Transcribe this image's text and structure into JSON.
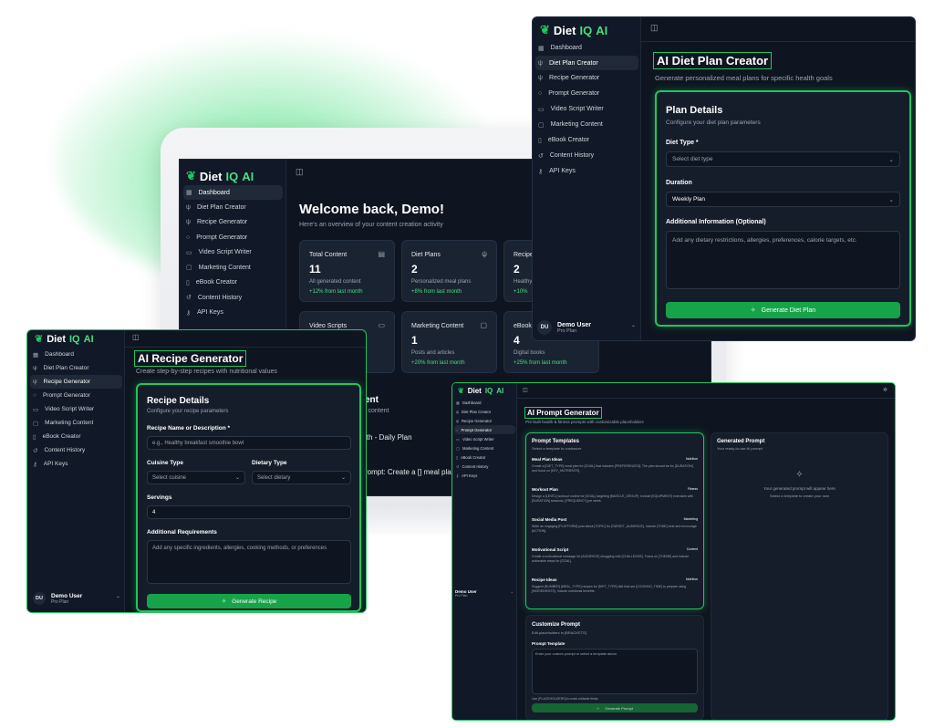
{
  "brand": {
    "diet": "Diet",
    "iq": "IQ",
    "ai": "AI"
  },
  "nav": [
    "Dashboard",
    "Diet Plan Creator",
    "Recipe Generator",
    "Prompt Generator",
    "Video Script Writer",
    "Marketing Content",
    "eBook Creator",
    "Content History",
    "API Keys"
  ],
  "user": {
    "initials": "DU",
    "name": "Demo User",
    "plan": "Pro Plan"
  },
  "dashboard": {
    "title": "Welcome back, Demo!",
    "subtitle": "Here's an overview of your content creation activity",
    "stats": [
      {
        "label": "Total Content",
        "value": "11",
        "desc": "All generated content",
        "trend": "+12% from last month"
      },
      {
        "label": "Diet Plans",
        "value": "2",
        "desc": "Personalized meal plans",
        "trend": "+8% from last month"
      },
      {
        "label": "Recipe",
        "value": "2",
        "desc": "Healthy",
        "trend": "+10%"
      },
      {
        "label": "Video Scripts",
        "value": "",
        "desc": "",
        "trend": ""
      },
      {
        "label": "Marketing Content",
        "value": "1",
        "desc": "Posts and articles",
        "trend": "+20% from last month"
      },
      {
        "label": "eBooks",
        "value": "4",
        "desc": "Digital books",
        "trend": "+25% from last month"
      }
    ],
    "recent_heading": "ent",
    "recent_sub": "l content",
    "recent_1": "lth - Daily Plan",
    "recent_2": "rompt: Create a [] meal pla"
  },
  "diet": {
    "title": "AI Diet Plan Creator",
    "subtitle": "Generate personalized meal plans for specific health goals",
    "card_title": "Plan Details",
    "card_sub": "Configure your diet plan parameters",
    "diet_type_label": "Diet Type *",
    "diet_type_placeholder": "Select diet type",
    "duration_label": "Duration",
    "duration_value": "Weekly Plan",
    "info_label": "Additional Information (Optional)",
    "info_placeholder": "Add any dietary restrictions, allergies, preferences, calorie targets, etc.",
    "button": "Generate Diet Plan"
  },
  "recipe": {
    "title": "AI Recipe Generator",
    "subtitle": "Create step-by-step recipes with nutritional values",
    "card_title": "Recipe Details",
    "card_sub": "Configure your recipe parameters",
    "name_label": "Recipe Name or Description *",
    "name_placeholder": "e.g., Healthy breakfast smoothie bowl",
    "cuisine_label": "Cuisine Type",
    "cuisine_placeholder": "Select cuisine",
    "dietary_label": "Dietary Type",
    "dietary_placeholder": "Select dietary",
    "servings_label": "Servings",
    "servings_value": "4",
    "req_label": "Additional Requirements",
    "req_placeholder": "Add any specific ingredients, allergies, cooking methods, or preferences",
    "button": "Generate Recipe"
  },
  "prompt": {
    "title": "AI Prompt Generator",
    "subtitle": "Pre-built health & fitness prompts with customizable placeholders",
    "templates_title": "Prompt Templates",
    "templates_sub": "Select a template to customize",
    "templates": [
      {
        "name": "Meal Plan Ideas",
        "tag": "Nutrition",
        "text": "Create a [DIET_TYPE] meal plan for [GOAL] that includes [PREFERENCES]. The plan should be for [DURATION] and focus on [KEY_NUTRIENTS]."
      },
      {
        "name": "Workout Plan",
        "tag": "Fitness",
        "text": "Design a [LEVEL] workout routine for [GOAL] targeting [MUSCLE_GROUP]. Include [EQUIPMENT] exercises with [DURATION] sessions, [FREQUENCY] per week."
      },
      {
        "name": "Social Media Post",
        "tag": "Marketing",
        "text": "Write an engaging [PLATFORM] post about [TOPIC] for [TARGET_AUDIENCE]. Include [TONE] tone and encourage [ACTION]."
      },
      {
        "name": "Motivational Script",
        "tag": "Content",
        "text": "Create a motivational message for [AUDIENCE] struggling with [CHALLENGE]. Focus on [THEME] and include actionable steps for [GOAL]."
      },
      {
        "name": "Recipe Ideas",
        "tag": "Nutrition",
        "text": "Suggest [NUMBER] [MEAL_TYPE] recipes for [DIET_TYPE] diet that are [COOKING_TIME] to prepare using [INGREDIENTS]. Include nutritional benefits."
      }
    ],
    "generated_title": "Generated Prompt",
    "generated_sub": "Your ready-to-use AI prompt",
    "empty_1": "Your generated prompt will appear here",
    "empty_2": "Select a template to create your own",
    "customize_title": "Customize Prompt",
    "customize_sub": "Edit placeholders in [BRACKETS]",
    "template_label": "Prompt Template",
    "template_placeholder": "Enter your custom prompt or select a template above",
    "hint": "Use [PLACEHOLDERS] to mark editable fields",
    "button": "Generate Prompt"
  }
}
